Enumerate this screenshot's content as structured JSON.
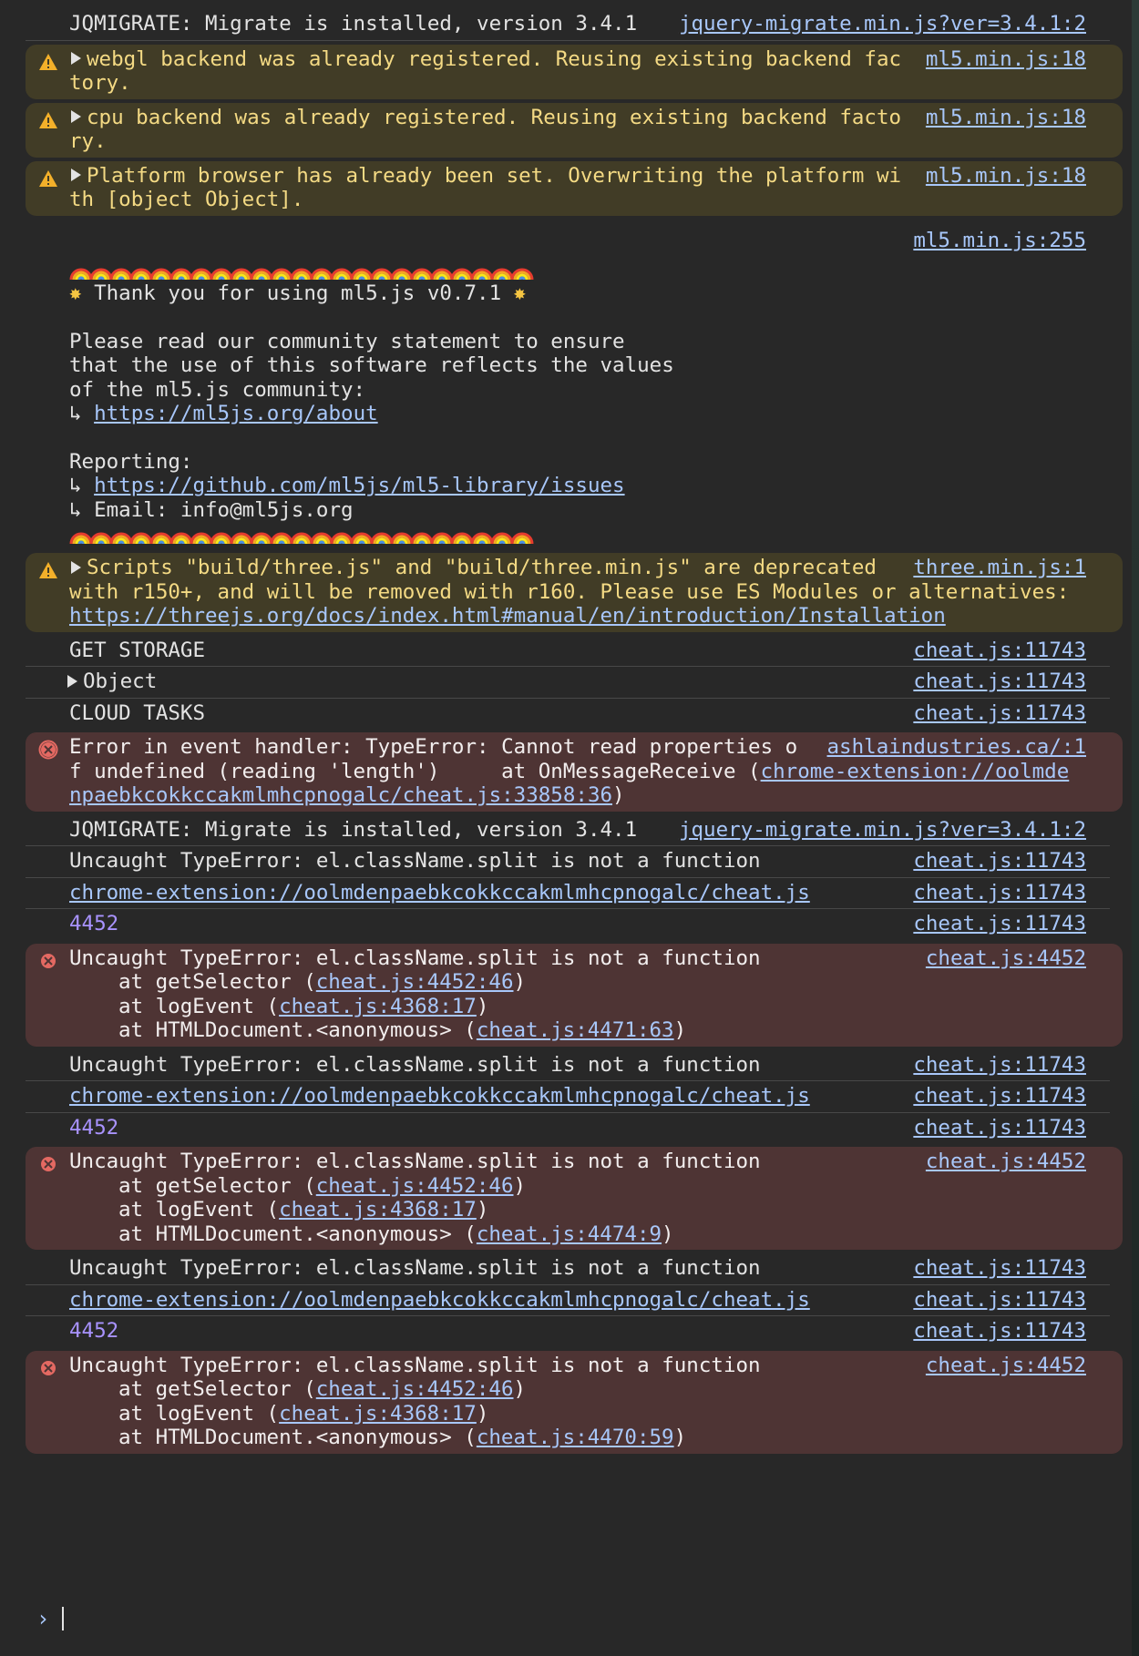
{
  "messages": [
    {
      "id": "m1",
      "type": "plain",
      "text": "JQMIGRATE: Migrate is installed, version 3.4.1",
      "source": "jquery-migrate.min.js?ver=3.4.1:2"
    },
    {
      "id": "m2",
      "type": "warn",
      "text": "webgl backend was already registered. Reusing existing backend factory.",
      "source": "ml5.min.js:18"
    },
    {
      "id": "m3",
      "type": "warn",
      "text": "cpu backend was already registered. Reusing existing backend factory.",
      "source": "ml5.min.js:18"
    },
    {
      "id": "m4",
      "type": "warn",
      "text": "Platform browser has already been set. Overwriting the platform with [object Object].",
      "source": "ml5.min.js:18"
    },
    {
      "id": "m5",
      "type": "banner",
      "source": "ml5.min.js:255",
      "thanks": "Thank you for using ml5.js v0.7.1",
      "statement": "Please read our community statement to ensure\nthat the use of this software reflects the values\nof the ml5.js community:",
      "arrow": "↳",
      "about_link": "https://ml5js.org/about",
      "reporting": "Reporting:",
      "issues_link": "https://github.com/ml5js/ml5-library/issues",
      "email": "Email: info@ml5js.org"
    },
    {
      "id": "m6",
      "type": "warn",
      "text": "Scripts \"build/three.js\" and \"build/three.min.js\" are deprecated with r150+, and will be removed with r160. Please use ES Modules or alternatives: ",
      "link": "https://threejs.org/docs/index.html#manual/en/introduction/Installation",
      "source": "three.min.js:1"
    },
    {
      "id": "m7",
      "type": "plain",
      "text": "GET STORAGE",
      "source": "cheat.js:11743"
    },
    {
      "id": "m8",
      "type": "plain",
      "text": "Object",
      "source": "cheat.js:11743",
      "expandable": true
    },
    {
      "id": "m9",
      "type": "plain",
      "text": "CLOUD TASKS",
      "source": "cheat.js:11743"
    },
    {
      "id": "m10",
      "type": "error",
      "text": "Error in event handler: TypeError: Cannot read properties of undefined (reading 'length')",
      "stack_prefix": "    at OnMessageReceive (",
      "stack_link": "chrome-extension://oolmdenpaebkcokkccakmlmhcpnogalc/cheat.js:33858:36",
      "stack_suffix": ")",
      "source": "ashlaindustries.ca/:1"
    },
    {
      "id": "m11",
      "type": "plain",
      "text": "JQMIGRATE: Migrate is installed, version 3.4.1",
      "source": "jquery-migrate.min.js?ver=3.4.1:2"
    },
    {
      "id": "m12",
      "type": "plain",
      "text": "Uncaught TypeError: el.className.split is not a function",
      "source": "cheat.js:11743"
    },
    {
      "id": "m13",
      "type": "plain-link",
      "text": "chrome-extension://oolmdenpaebkcokkccakmlmhcpnogalc/cheat.js",
      "source": "cheat.js:11743"
    },
    {
      "id": "m14",
      "type": "plain-num",
      "text": "4452",
      "source": "cheat.js:11743"
    },
    {
      "id": "m15",
      "type": "error-stack",
      "text": "Uncaught TypeError: el.className.split is not a function",
      "source": "cheat.js:4452",
      "stack": [
        {
          "pre": "at getSelector (",
          "link": "cheat.js:4452:46",
          "post": ")"
        },
        {
          "pre": "at logEvent (",
          "link": "cheat.js:4368:17",
          "post": ")"
        },
        {
          "pre": "at HTMLDocument.<anonymous> (",
          "link": "cheat.js:4471:63",
          "post": ")"
        }
      ]
    },
    {
      "id": "m16",
      "type": "plain",
      "text": "Uncaught TypeError: el.className.split is not a function",
      "source": "cheat.js:11743"
    },
    {
      "id": "m17",
      "type": "plain-link",
      "text": "chrome-extension://oolmdenpaebkcokkccakmlmhcpnogalc/cheat.js",
      "source": "cheat.js:11743"
    },
    {
      "id": "m18",
      "type": "plain-num",
      "text": "4452",
      "source": "cheat.js:11743"
    },
    {
      "id": "m19",
      "type": "error-stack",
      "text": "Uncaught TypeError: el.className.split is not a function",
      "source": "cheat.js:4452",
      "stack": [
        {
          "pre": "at getSelector (",
          "link": "cheat.js:4452:46",
          "post": ")"
        },
        {
          "pre": "at logEvent (",
          "link": "cheat.js:4368:17",
          "post": ")"
        },
        {
          "pre": "at HTMLDocument.<anonymous> (",
          "link": "cheat.js:4474:9",
          "post": ")"
        }
      ]
    },
    {
      "id": "m20",
      "type": "plain",
      "text": "Uncaught TypeError: el.className.split is not a function",
      "source": "cheat.js:11743"
    },
    {
      "id": "m21",
      "type": "plain-link",
      "text": "chrome-extension://oolmdenpaebkcokkccakmlmhcpnogalc/cheat.js",
      "source": "cheat.js:11743"
    },
    {
      "id": "m22",
      "type": "plain-num",
      "text": "4452",
      "source": "cheat.js:11743"
    },
    {
      "id": "m23",
      "type": "error-stack",
      "text": "Uncaught TypeError: el.className.split is not a function",
      "source": "cheat.js:4452",
      "stack": [
        {
          "pre": "at getSelector (",
          "link": "cheat.js:4452:46",
          "post": ")"
        },
        {
          "pre": "at logEvent (",
          "link": "cheat.js:4368:17",
          "post": ")"
        },
        {
          "pre": "at HTMLDocument.<anonymous> (",
          "link": "cheat.js:4470:59",
          "post": ")"
        }
      ]
    }
  ],
  "prompt": {
    "symbol": "›"
  },
  "colors": {
    "warn_bg": "#413c26",
    "warn_text": "#f4da84",
    "error_bg": "#4e3434",
    "link": "#a8c7fa",
    "number": "#a993ff",
    "background": "#282828"
  },
  "icons": {
    "warning": "warning-triangle-icon",
    "error": "error-circle-x-icon",
    "expand": "expand-triangle-icon",
    "rainbow": "rainbow-emoji",
    "star": "glowing-star-emoji"
  }
}
